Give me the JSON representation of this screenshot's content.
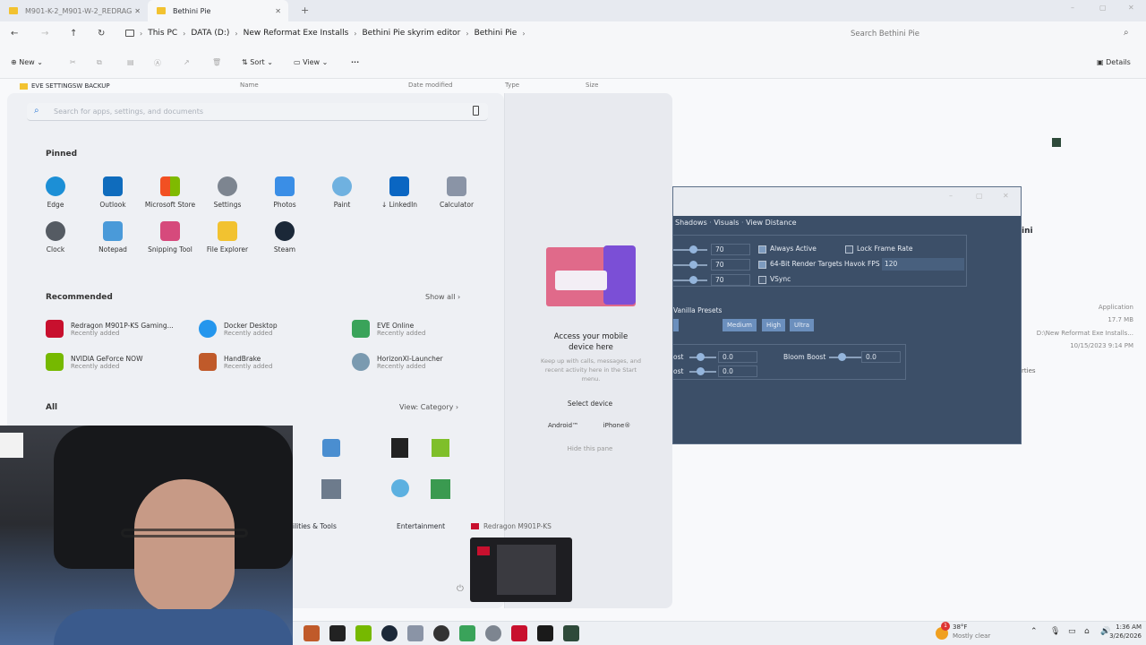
{
  "tabs": [
    {
      "title": "M901-K-2_M901-W-2_REDRAG"
    },
    {
      "title": "Bethini Pie"
    }
  ],
  "breadcrumb": [
    "This PC",
    "DATA (D:)",
    "New Reformat Exe Installs",
    "Bethini Pie skyrim editor",
    "Bethini Pie"
  ],
  "explorer_search_placeholder": "Search Bethini Pie",
  "commands": {
    "new": "New",
    "sort": "Sort",
    "view": "View",
    "more": "···",
    "details": "Details"
  },
  "nav_pane_item": "EVE SETTINGSW BACKUP",
  "columns": [
    "Name",
    "Date modified",
    "Type",
    "Size"
  ],
  "properties": {
    "type": "Application",
    "size": "17.7 MB",
    "path": "D:\\New Reformat Exe Installs...",
    "date": "10/15/2023 9:14 PM",
    "partial": "rties",
    "title_partial": "ini"
  },
  "start": {
    "search_placeholder": "Search for apps, settings, and documents",
    "pinned_title": "Pinned",
    "pinned": [
      {
        "label": "Edge",
        "icon": "edge-icon",
        "color": "#1c8fd6"
      },
      {
        "label": "Outlook",
        "icon": "outlook-icon",
        "color": "#0f6cbd"
      },
      {
        "label": "Microsoft Store",
        "icon": "store-icon",
        "color": "#2b79d6"
      },
      {
        "label": "Settings",
        "icon": "gear-icon",
        "color": "#7d8590"
      },
      {
        "label": "Photos",
        "icon": "photos-icon",
        "color": "#3a8ee6"
      },
      {
        "label": "Paint",
        "icon": "paint-icon",
        "color": "#6fb1e0"
      },
      {
        "label": "↓ LinkedIn",
        "icon": "linkedin-icon",
        "color": "#0a66c2"
      },
      {
        "label": "Calculator",
        "icon": "calculator-icon",
        "color": "#8a94a6"
      },
      {
        "label": "Clock",
        "icon": "clock-icon",
        "color": "#555b63"
      },
      {
        "label": "Notepad",
        "icon": "notepad-icon",
        "color": "#4a9ad9"
      },
      {
        "label": "Snipping Tool",
        "icon": "snipping-icon",
        "color": "#d64a7c"
      },
      {
        "label": "File Explorer",
        "icon": "folder-icon",
        "color": "#f2c230"
      },
      {
        "label": "Steam",
        "icon": "steam-icon",
        "color": "#1b2838"
      }
    ],
    "recommended_title": "Recommended",
    "show_all": "Show all",
    "recommended": [
      {
        "name": "Redragon M901P-KS Gaming...",
        "sub": "Recently added",
        "icon": "redragon-icon",
        "color": "#c8102e"
      },
      {
        "name": "Docker Desktop",
        "sub": "Recently added",
        "icon": "docker-icon",
        "color": "#2496ed"
      },
      {
        "name": "EVE Online",
        "sub": "Recently added",
        "icon": "eve-icon",
        "color": "#3aa35a"
      },
      {
        "name": "NVIDIA GeForce NOW",
        "sub": "Recently added",
        "icon": "nvidia-icon",
        "color": "#76b900"
      },
      {
        "name": "HandBrake",
        "sub": "Recently added",
        "icon": "handbrake-icon",
        "color": "#c05a2a"
      },
      {
        "name": "HorizonXI-Launcher",
        "sub": "Recently added",
        "icon": "horizon-icon",
        "color": "#7a9ab0"
      }
    ],
    "all_title": "All",
    "view_category": "View: Category",
    "categories": [
      "ilities & Tools",
      "Entertainment"
    ],
    "hover_label": "Redragon M901P-KS"
  },
  "mobile": {
    "title": "Access your mobile device here",
    "desc": "Keep up with calls, messages, and recent activity here in the Start menu.",
    "select": "Select device",
    "android": "Android™",
    "iphone": "iPhone®",
    "hide": "Hide this pane"
  },
  "bethini": {
    "tabs": [
      "Shadows",
      "Visuals",
      "View Distance"
    ],
    "sliders": [
      "70",
      "70",
      "70"
    ],
    "checks": [
      {
        "label": "Always Active",
        "checked": true
      },
      {
        "label": "64-Bit Render Targets",
        "checked": true
      },
      {
        "label": "VSync",
        "checked": false
      }
    ],
    "lock_frame_rate": "Lock Frame Rate",
    "havok_label": "Havok FPS",
    "havok_value": "120",
    "presets_title": "Vanilla Presets",
    "presets": [
      "Medium",
      "High",
      "Ultra"
    ],
    "boost_a": "ost",
    "boost_b": "ost",
    "boost_values": [
      "0.0",
      "0.0"
    ],
    "bloom_label": "Bloom Boost",
    "bloom_value": "0.0"
  },
  "tray": {
    "temp": "38°F",
    "weather": "Mostly clear",
    "time": "1:36 AM",
    "date": "3/26/2026",
    "badge": "1"
  }
}
